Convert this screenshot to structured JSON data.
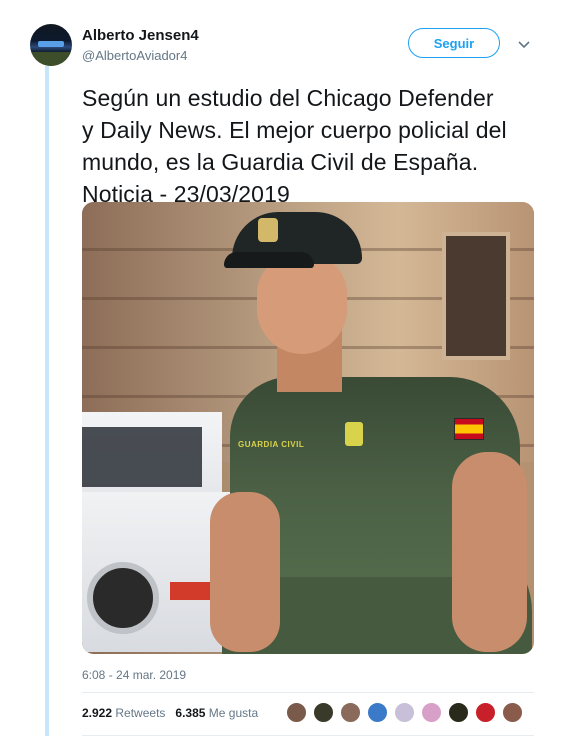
{
  "user": {
    "name": "Alberto Jensen4",
    "handle": "@AlbertoAviador4"
  },
  "actions": {
    "follow_label": "Seguir"
  },
  "tweet": {
    "text": "Según un estudio del Chicago Defender\ny Daily News. El mejor cuerpo policial del\nmundo, es la Guardia Civil de España.\nNoticia - 23/03/2019",
    "image_text": "GUARDIA CIVIL",
    "timestamp": "6:08 - 24 mar. 2019"
  },
  "stats": {
    "retweets_count": "2.922",
    "retweets_label": "Retweets",
    "likes_count": "6.385",
    "likes_label": "Me gusta"
  },
  "likers": [
    {
      "color": "#7a5a4a"
    },
    {
      "color": "#3a3a2a"
    },
    {
      "color": "#8a6a5a"
    },
    {
      "color": "#3a7ac8"
    },
    {
      "color": "#c8c0d8"
    },
    {
      "color": "#d8a0c8"
    },
    {
      "color": "#2a2a1a"
    },
    {
      "color": "#c8202a"
    },
    {
      "color": "#8a5a4a"
    }
  ],
  "colors": {
    "accent": "#1da1f2",
    "text_primary": "#14171a",
    "text_secondary": "#657786"
  },
  "icons": [
    "chevron-down-icon"
  ]
}
